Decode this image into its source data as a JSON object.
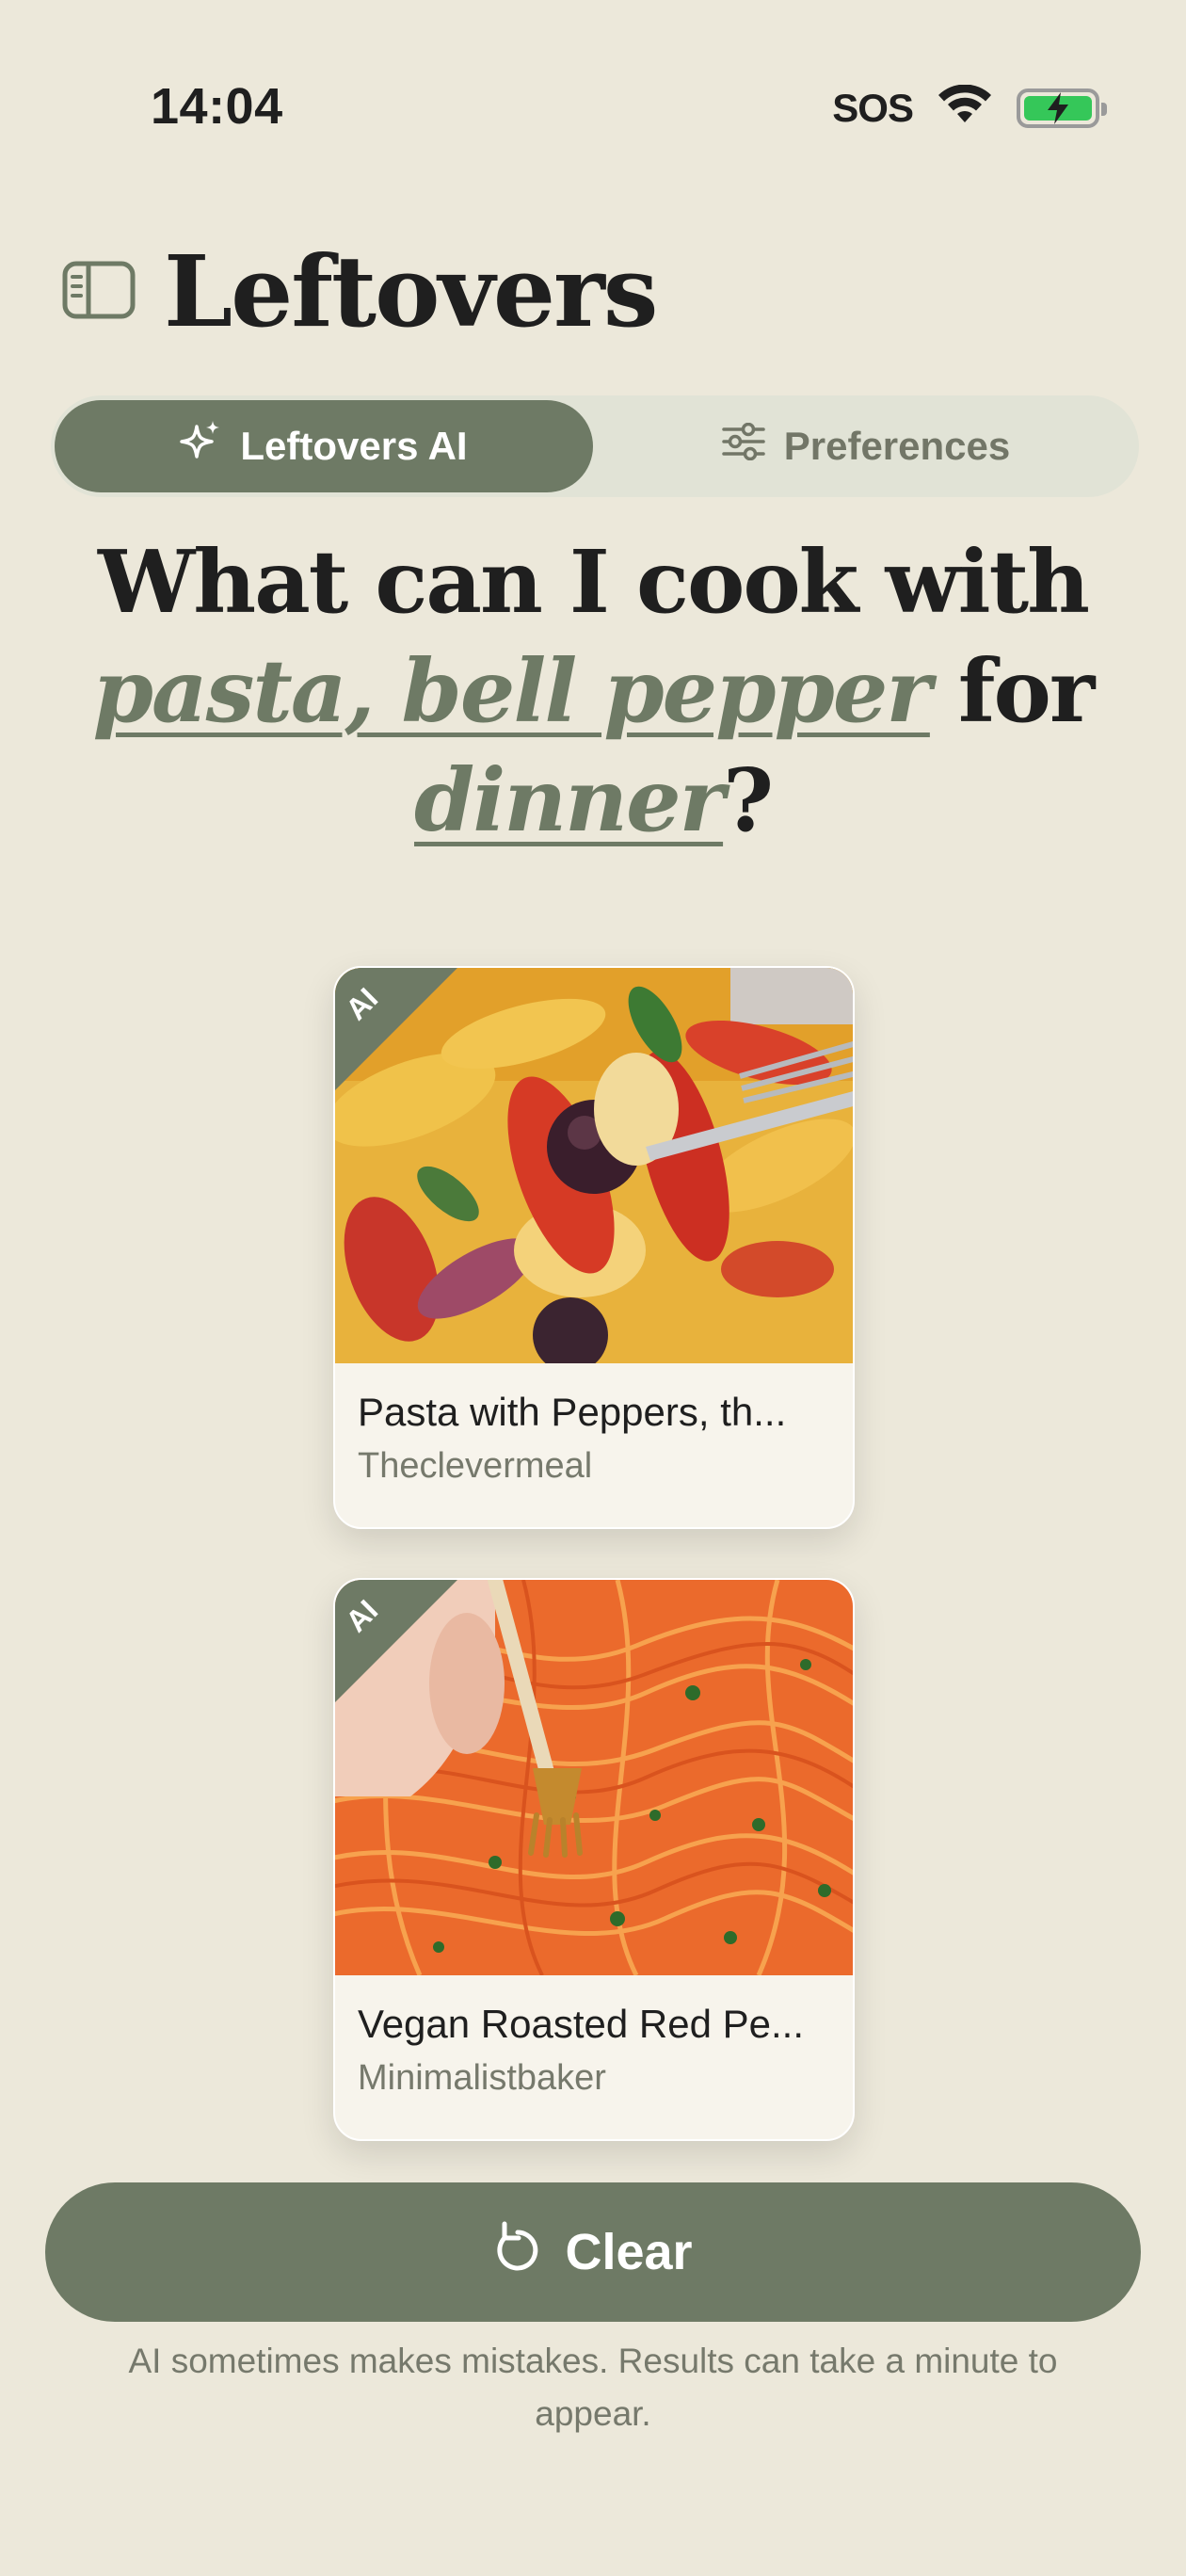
{
  "status_bar": {
    "time": "14:04",
    "sos": "SOS",
    "icons": [
      "wifi-icon",
      "battery-charging-icon"
    ]
  },
  "header": {
    "title": "Leftovers",
    "sidebar_icon": "sidebar-icon"
  },
  "tabs": [
    {
      "label": "Leftovers AI",
      "icon": "sparkle-icon",
      "active": true
    },
    {
      "label": "Preferences",
      "icon": "sliders-icon",
      "active": false
    }
  ],
  "headline": {
    "prefix": "What can I cook with",
    "ingredients": "pasta, bell pepper",
    "middle": "for",
    "meal": "dinner",
    "suffix": "?"
  },
  "recipes": [
    {
      "badge": "AI",
      "title": "Pasta with Peppers, th...",
      "source": "Theclevermeal"
    },
    {
      "badge": "AI",
      "title": "Vegan Roasted Red Pe...",
      "source": "Minimalistbaker"
    }
  ],
  "actions": {
    "clear_label": "Clear",
    "clear_icon": "reset-icon"
  },
  "disclaimer": "AI sometimes makes mistakes. Results can take a minute to appear.",
  "colors": {
    "background": "#ECE8DA",
    "accent": "#6E7A65",
    "segment_track": "#E1E3D6",
    "card": "#F7F4EC",
    "muted_text": "#76796C"
  }
}
